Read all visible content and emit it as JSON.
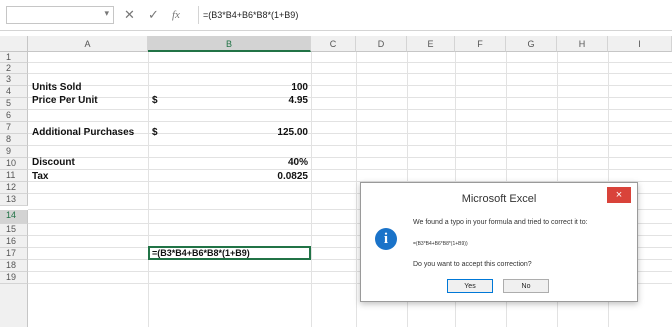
{
  "formula_bar": {
    "cancel_icon": "x-icon",
    "enter_icon": "check-icon",
    "function_icon": "fx-icon",
    "cancel_glyph": "✕",
    "enter_glyph": "✓",
    "fx_glyph": "fx",
    "formula": "=(B3*B4+B6*B8*(1+B9)"
  },
  "columns": [
    "A",
    "B",
    "C",
    "D",
    "E",
    "F",
    "G",
    "H",
    "I"
  ],
  "rows": [
    "1",
    "2",
    "3",
    "4",
    "5",
    "6",
    "7",
    "8",
    "9",
    "10",
    "11",
    "12",
    "13",
    "14",
    "15",
    "16",
    "17",
    "18",
    "19"
  ],
  "cells": {
    "a3": "Units Sold",
    "b3": "100",
    "a4": "Price Per Unit",
    "b4_sym": "$",
    "b4": "4.95",
    "a6": "Additional Purchases",
    "b6_sym": "$",
    "b6": "125.00",
    "a8": "Discount",
    "b8": "40%",
    "a9": "Tax",
    "b9": "0.0825",
    "b14": "=(B3*B4+B6*B8*(1+B9)"
  },
  "dialog": {
    "title": "Microsoft Excel",
    "close_glyph": "×",
    "icon": "info-icon",
    "icon_glyph": "i",
    "message": "We found a typo in your formula and tried to correct it to:",
    "suggested_formula": "=(B3*B4+B6*B8*(1+B9))",
    "question": "Do you want to accept this correction?",
    "yes_label": "Yes",
    "no_label": "No"
  },
  "colors": {
    "accent": "#217346",
    "dialog_close": "#d9433a",
    "info": "#1a73c9"
  }
}
